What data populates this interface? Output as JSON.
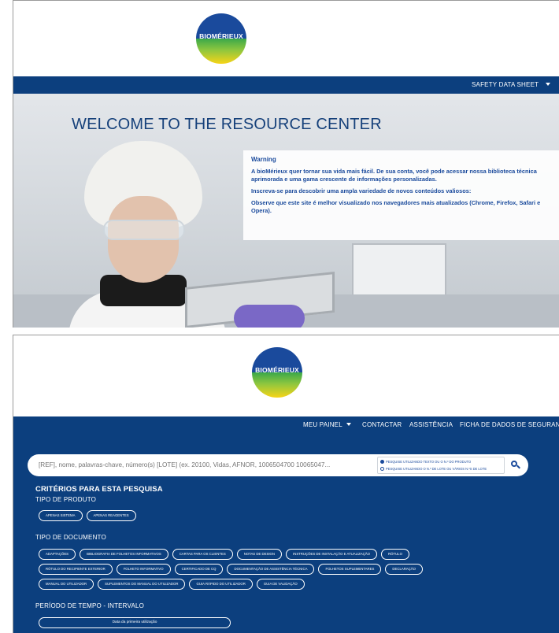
{
  "brand": {
    "logo_text": "BIOMÉRIEUX"
  },
  "screen1": {
    "nav": {
      "item": "SAFETY DATA SHEET"
    },
    "hero_title": "WELCOME TO THE RESOURCE CENTER",
    "warning": {
      "title": "Warning",
      "p1": "A bioMérieux quer tornar sua vida mais fácil. De sua conta, você pode acessar nossa biblioteca técnica aprimorada e uma gama crescente de informações personalizadas.",
      "p2": "Inscreva-se para descobrir uma ampla variedade de novos conteúdos valiosos:",
      "p3": "Observe que este site é melhor visualizado nos navegadores mais atualizados (Chrome, Firefox, Safari e Opera)."
    }
  },
  "screen2": {
    "nav": {
      "items": [
        "MEU PAINEL",
        "CONTACTAR",
        "ASSISTÊNCIA",
        "FICHA DE DADOS DE SEGURANÇA (F"
      ]
    },
    "search": {
      "placeholder": "[REF], nome, palavras-chave, número(s) [LOTE] (ex. 20100, Vidas, AFNOR, 1006504700 10065047...",
      "options": [
        {
          "label": "PESQUISE UTILIZANDO TEXTO OU O N.º DO PRODUTO",
          "checked": true
        },
        {
          "label": "PESQUISE UTILIZANDO O N.º DE LOTE OU VÁRIOS N.ºS DE LOTE",
          "checked": false
        }
      ]
    },
    "criteria_title": "CRITÉRIOS PARA ESTA PESQUISA",
    "product_type": {
      "label": "TIPO DE PRODUTO",
      "options": [
        "APENAS SISTEMA",
        "APENAS REAGENTES"
      ]
    },
    "document_type": {
      "label": "TIPO DE DOCUMENTO",
      "rows": [
        [
          "ADAPTAÇÕES",
          "BIBLIOGRAFIA DE FOLHETOS INFORMATIVOS",
          "CARTAS PARA OS CLIENTES",
          "NOTAS DE DESIGN",
          "INSTRUÇÕES DE INSTALAÇÃO E ATUALIZAÇÃO",
          "RÓTULO"
        ],
        [
          "RÓTULO DO RECIPIENTE EXTERIOR",
          "FOLHETO INFORMATIVO",
          "CERTIFICADO DE CQ",
          "DOCUMENTAÇÃO DE ASSISTÊNCIA TÉCNICA",
          "FOLHETOS SUPLEMENTARES",
          "DECLARAÇÃO"
        ],
        [
          "MANUAL DO UTILIZADOR",
          "SUPLEMENTOS DO MANUAL DO UTILIZADOR",
          "GUIA RÁPIDO DO UTILIZADOR",
          "GUIA DE VALIDAÇÃO"
        ]
      ]
    },
    "period": {
      "label": "PERÍODO DE TEMPO - INTERVALO",
      "first_use": "Data da primeira utilização"
    }
  }
}
